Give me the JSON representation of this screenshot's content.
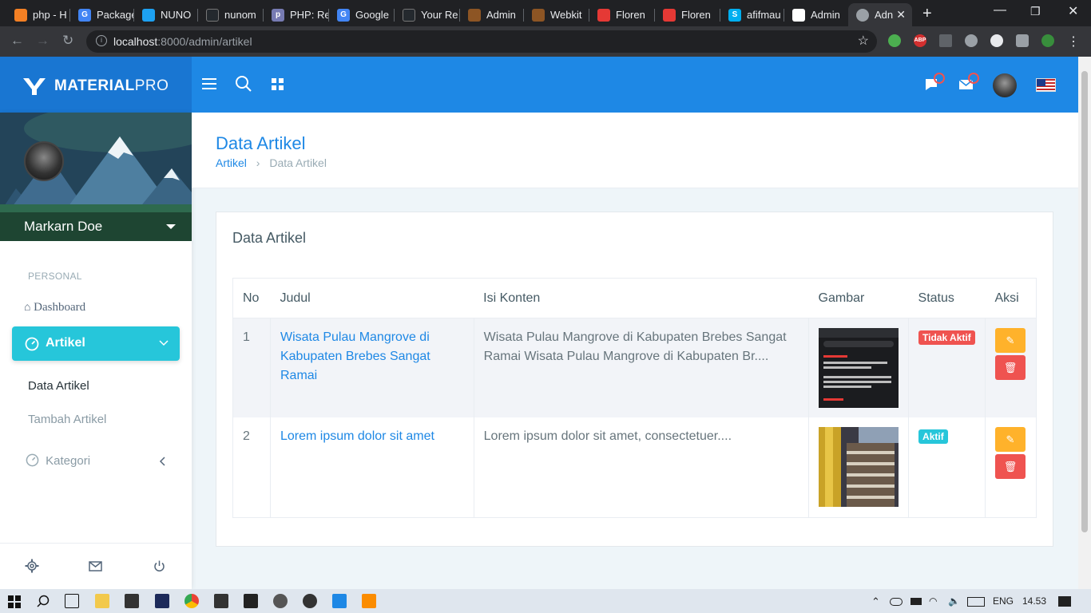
{
  "browser": {
    "tabs": [
      {
        "label": "php - H",
        "color": "#f48024"
      },
      {
        "label": "Package",
        "color": "#4285f4"
      },
      {
        "label": "NUNO",
        "color": "#1da1f2"
      },
      {
        "label": "nunom",
        "color": "#24292e"
      },
      {
        "label": "PHP: Re",
        "color": "#777bb3"
      },
      {
        "label": "Google",
        "color": "#4285f4"
      },
      {
        "label": "Your Re",
        "color": "#24292e"
      },
      {
        "label": "Admin",
        "color": "#8d5524"
      },
      {
        "label": "Webkit",
        "color": "#8d5524"
      },
      {
        "label": "Floren",
        "color": "#e53935"
      },
      {
        "label": "Floren",
        "color": "#e53935"
      },
      {
        "label": "afifmau",
        "color": "#00aff0"
      },
      {
        "label": "Admin",
        "color": "#ffffff"
      },
      {
        "label": "Adn",
        "color": "#9aa0a6"
      }
    ],
    "url_host": "localhost",
    "url_path": ":8000/admin/artikel"
  },
  "app": {
    "logo_bold": "MATERIAL",
    "logo_light": "PRO",
    "user_name": "Markarn Doe"
  },
  "sidebar": {
    "caption": "PERSONAL",
    "dashboard": "Dashboard",
    "artikel": "Artikel",
    "sub_data": "Data Artikel",
    "sub_tambah": "Tambah Artikel",
    "kategori": "Kategori"
  },
  "page": {
    "title": "Data Artikel",
    "breadcrumb_root": "Artikel",
    "breadcrumb_current": "Data Artikel",
    "card_title": "Data Artikel"
  },
  "table": {
    "headers": [
      "No",
      "Judul",
      "Isi Konten",
      "Gambar",
      "Status",
      "Aksi"
    ],
    "rows": [
      {
        "no": "1",
        "judul": "Wisata Pulau Mangrove di Kabupaten Brebes Sangat Ramai",
        "isi": "Wisata Pulau Mangrove di Kabupaten Brebes Sangat Ramai Wisata Pulau Mangrove di Kabupaten Br....",
        "status": "Tidak Aktif",
        "status_color": "#ef5350"
      },
      {
        "no": "2",
        "judul": "Lorem ipsum dolor sit amet",
        "isi": "Lorem ipsum dolor sit amet, consectetuer....",
        "status": "Aktif",
        "status_color": "#26c6da"
      }
    ]
  },
  "taskbar": {
    "lang": "ENG",
    "time": "14.53"
  },
  "colors": {
    "primary": "#1e88e5",
    "info": "#26c6da",
    "warning": "#ffb22b",
    "danger": "#ef5350"
  }
}
